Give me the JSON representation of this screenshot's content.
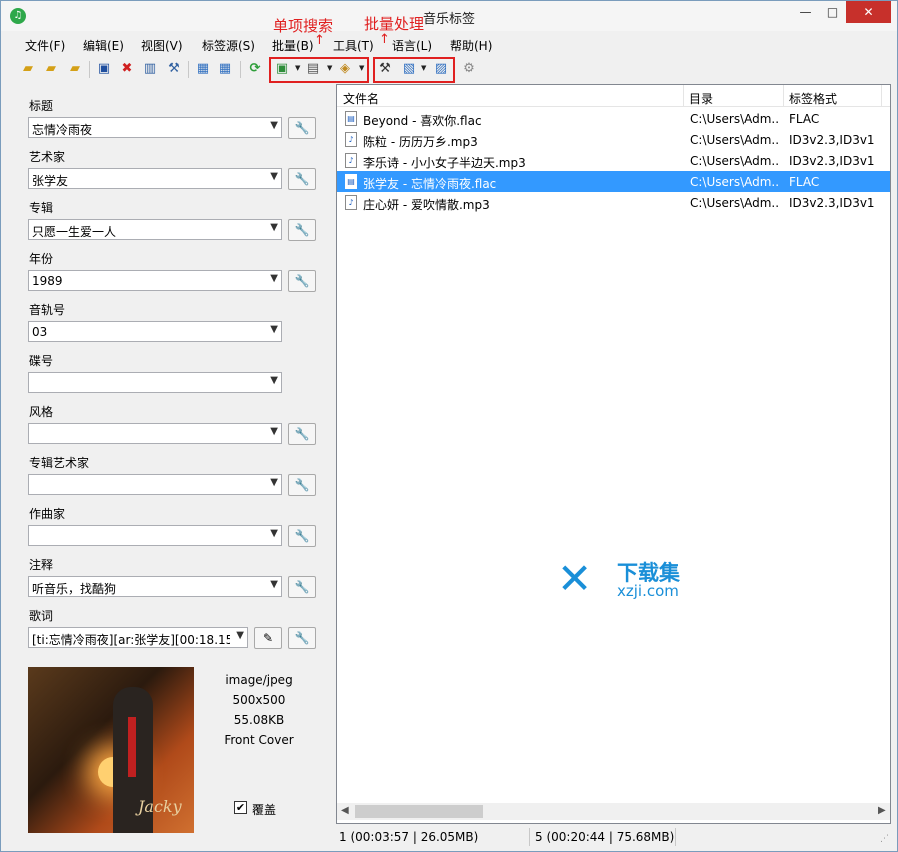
{
  "window": {
    "title": "音乐标签",
    "min": "—",
    "max": "□",
    "close": "✕"
  },
  "annotations": {
    "single_search": "单项搜索",
    "batch_process": "批量处理",
    "arrow": "↑"
  },
  "menu": [
    "文件(F)",
    "编辑(E)",
    "视图(V)",
    "标签源(S)",
    "批量(B)",
    "工具(T)",
    "语言(L)",
    "帮助(H)"
  ],
  "fields": {
    "title": {
      "label": "标题",
      "value": "忘情冷雨夜"
    },
    "artist": {
      "label": "艺术家",
      "value": "张学友"
    },
    "album": {
      "label": "专辑",
      "value": "只愿一生爱一人"
    },
    "year": {
      "label": "年份",
      "value": "1989"
    },
    "track": {
      "label": "音轨号",
      "value": "03"
    },
    "disc": {
      "label": "碟号",
      "value": ""
    },
    "genre": {
      "label": "风格",
      "value": ""
    },
    "album_artist": {
      "label": "专辑艺术家",
      "value": ""
    },
    "composer": {
      "label": "作曲家",
      "value": ""
    },
    "comment": {
      "label": "注释",
      "value": "听音乐，找酷狗"
    },
    "lyrics": {
      "label": "歌词",
      "value": "[ti:忘情冷雨夜][ar:张学友][00:18.15"
    }
  },
  "cover": {
    "mime": "image/jpeg",
    "size": "500x500",
    "filesize": "55.08KB",
    "type": "Front Cover",
    "overwrite_label": "覆盖",
    "overwrite_checked": "✔",
    "signature": "Jacky"
  },
  "list": {
    "columns": [
      "文件名",
      "目录",
      "标签格式"
    ],
    "rows": [
      {
        "name": "Beyond - 喜欢你.flac",
        "dir": "C:\\Users\\Adm...",
        "format": "FLAC",
        "selected": false
      },
      {
        "name": "陈粒 - 历历万乡.mp3",
        "dir": "C:\\Users\\Adm...",
        "format": "ID3v2.3,ID3v1",
        "selected": false
      },
      {
        "name": "李乐诗 - 小小女子半边天.mp3",
        "dir": "C:\\Users\\Adm...",
        "format": "ID3v2.3,ID3v1",
        "selected": false
      },
      {
        "name": "张学友 - 忘情冷雨夜.flac",
        "dir": "C:\\Users\\Adm...",
        "format": "FLAC",
        "selected": true
      },
      {
        "name": "庄心妍 - 爱吹情散.mp3",
        "dir": "C:\\Users\\Adm...",
        "format": "ID3v2.3,ID3v1",
        "selected": false
      }
    ]
  },
  "watermark": {
    "line1": "下载集",
    "line2": "xzji.com"
  },
  "status": {
    "selected": "1 (00:03:57 | 26.05MB)",
    "total": "5 (00:20:44 | 75.68MB)"
  },
  "colors": {
    "selection": "#3399ff",
    "annotation": "#e02020",
    "close": "#c7302b"
  }
}
